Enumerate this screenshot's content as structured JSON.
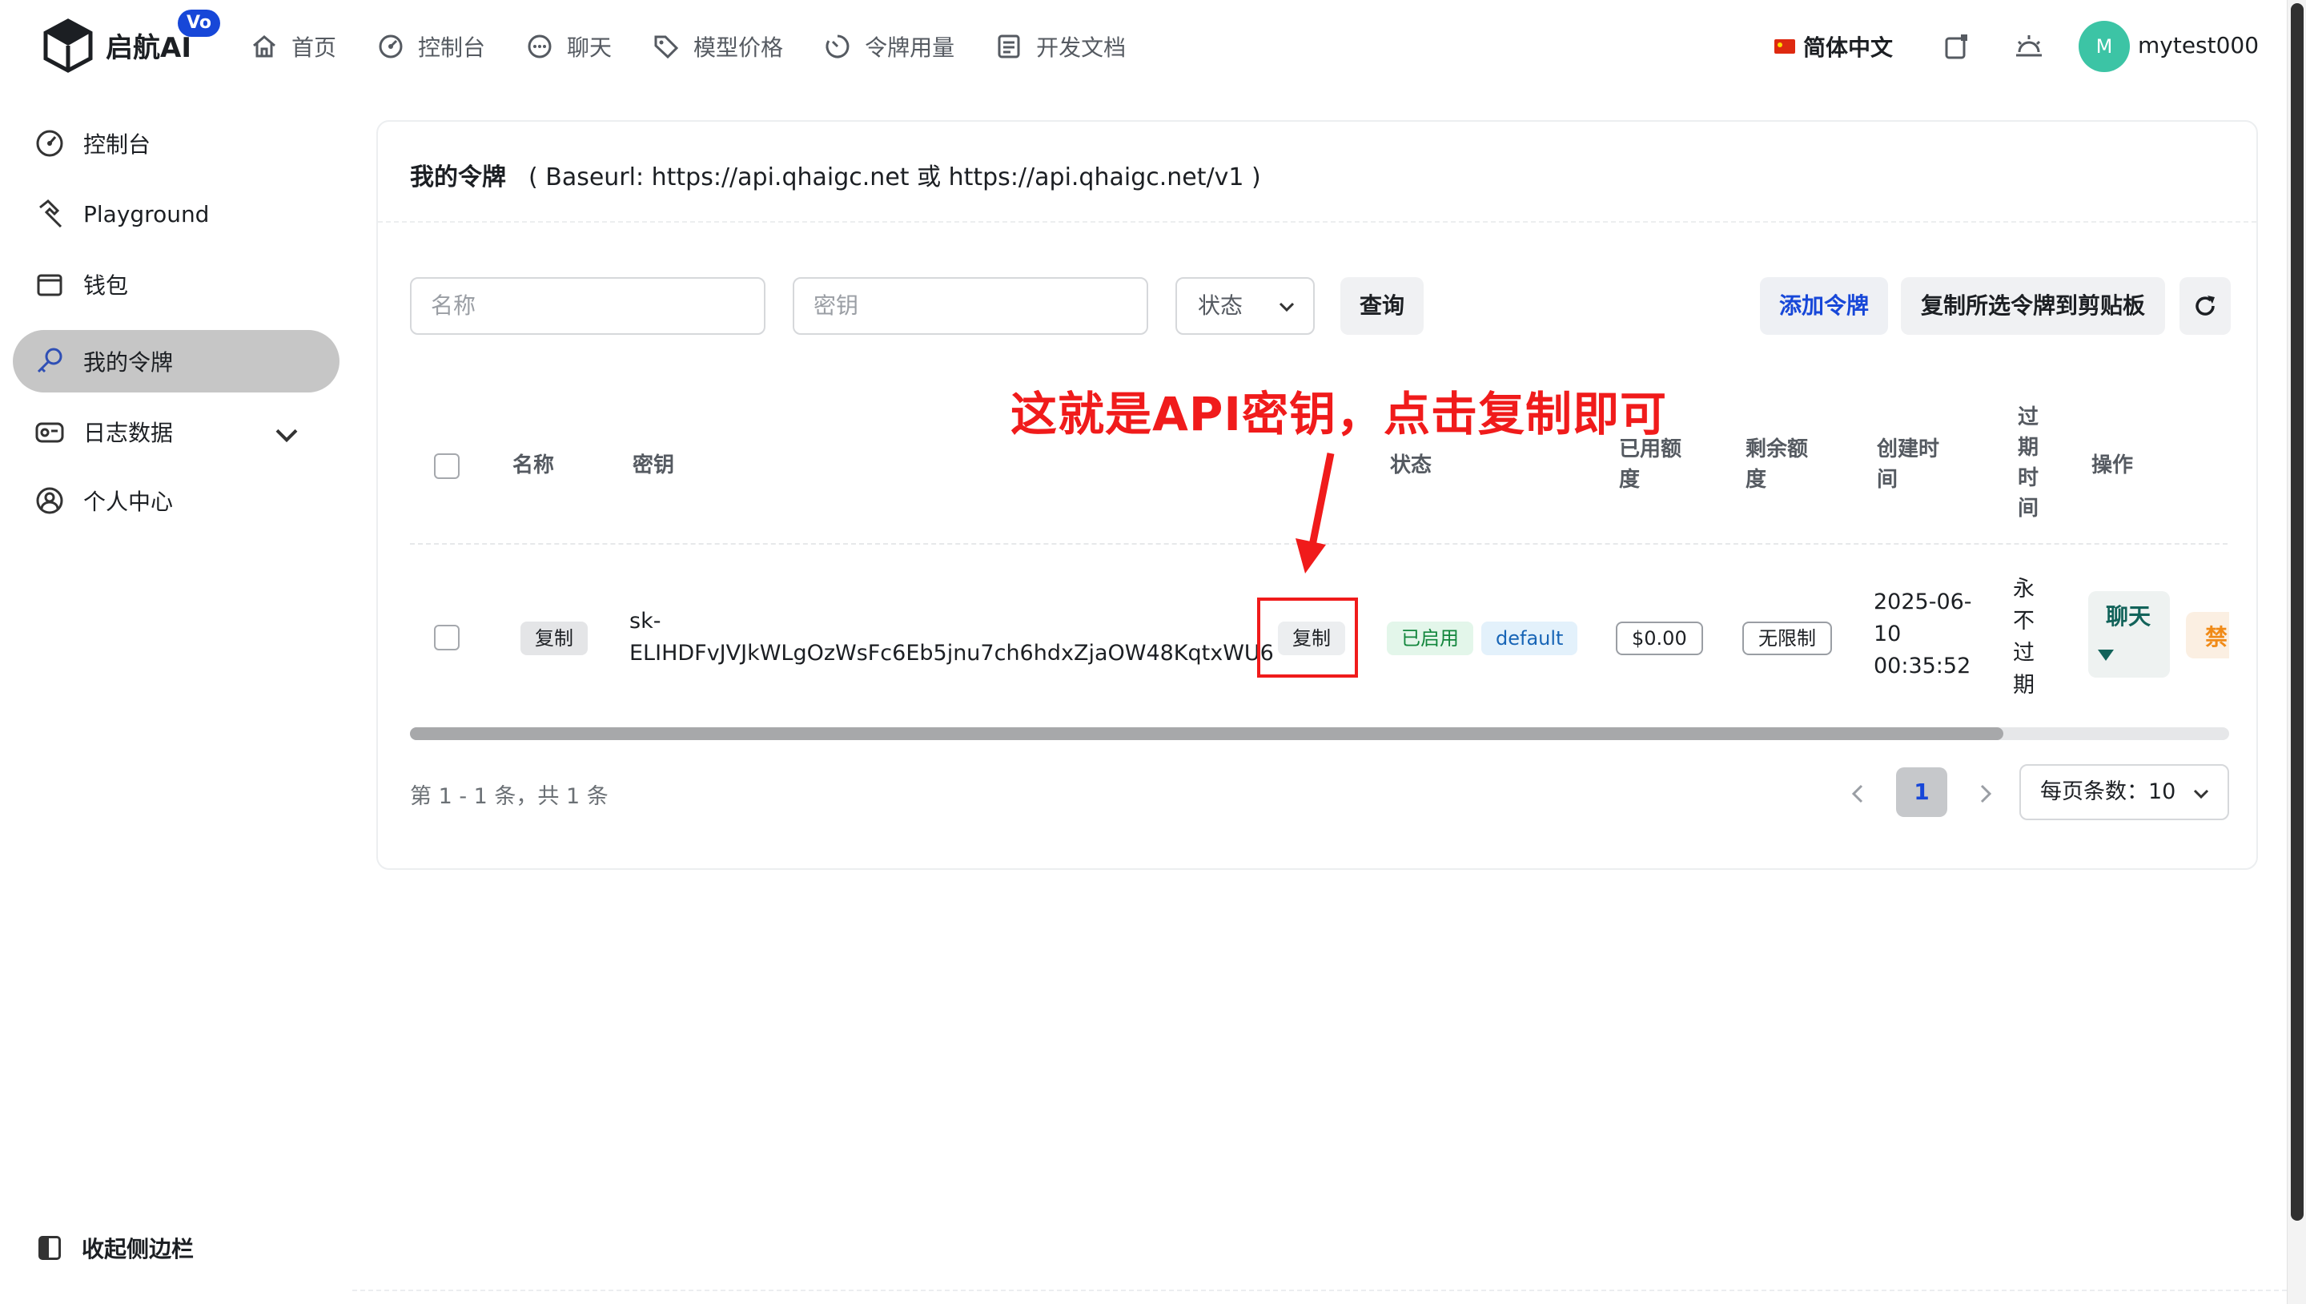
{
  "header": {
    "brand": "启航AI",
    "badge": "Vo",
    "nav": [
      {
        "label": "首页",
        "icon": "home-icon"
      },
      {
        "label": "控制台",
        "icon": "dashboard-icon"
      },
      {
        "label": "聊天",
        "icon": "chat-icon"
      },
      {
        "label": "模型价格",
        "icon": "tag-icon"
      },
      {
        "label": "令牌用量",
        "icon": "usage-icon"
      },
      {
        "label": "开发文档",
        "icon": "document-icon"
      }
    ],
    "language": "简体中文",
    "avatar_letter": "M",
    "username": "mytest000"
  },
  "sidebar": {
    "items": [
      {
        "label": "控制台",
        "icon": "dashboard-icon"
      },
      {
        "label": "Playground",
        "icon": "hammer-icon"
      },
      {
        "label": "钱包",
        "icon": "wallet-icon"
      },
      {
        "label": "我的令牌",
        "icon": "key-icon",
        "active": true
      },
      {
        "label": "日志数据",
        "icon": "log-icon"
      },
      {
        "label": "个人中心",
        "icon": "user-icon"
      }
    ],
    "collapse_label": "收起侧边栏"
  },
  "card": {
    "title": "我的令牌",
    "baseurl": "( Baseurl: https://api.qhaigc.net 或 https://api.qhaigc.net/v1 )"
  },
  "filters": {
    "name_placeholder": "名称",
    "key_placeholder": "密钥",
    "status_placeholder": "状态",
    "query_label": "查询",
    "add_label": "添加令牌",
    "copy_selected_label": "复制所选令牌到剪贴板"
  },
  "table": {
    "headers": {
      "name": "名称",
      "key": "密钥",
      "status": "状态",
      "used_quota": "已用额度",
      "remain_quota": "剩余额度",
      "created": "创建时间",
      "expire": "过期时间",
      "actions": "操作"
    },
    "rows": [
      {
        "name_copy": "复制",
        "key_prefix": "sk-",
        "key_body": "ELIHDFvJVJkWLgOzWsFc6Eb5jnu7ch6hdxZjaOW48KqtxWU6",
        "key_copy": "复制",
        "status": "已启用",
        "group": "default",
        "used": "$0.00",
        "remaining": "无限制",
        "created": "2025-06-10 00:35:52",
        "expire": "永不过期",
        "chat_action": "聊天",
        "disable_action": "禁"
      }
    ]
  },
  "pagination": {
    "summary": "第 1 - 1 条，共 1 条",
    "current_page": "1",
    "page_size_label": "每页条数：10"
  },
  "annotation": {
    "text": "这就是API密钥，点击复制即可",
    "color": "#f01b1b"
  },
  "colors": {
    "accent": "#1747d8",
    "success": "#12863c",
    "teal": "#3cc4a5"
  }
}
